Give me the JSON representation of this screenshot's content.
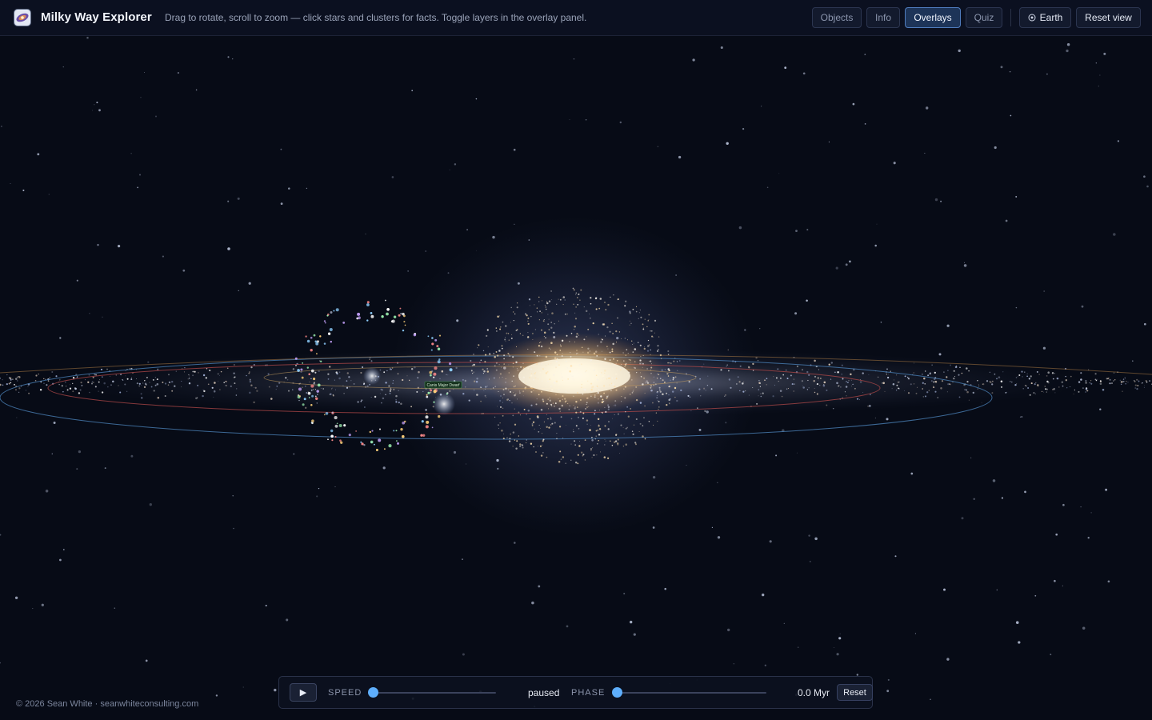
{
  "header": {
    "title": "Milky Way Explorer",
    "hint": "Drag to rotate, scroll to zoom — click stars and clusters for facts. Toggle layers in the overlay panel.",
    "tabs": [
      {
        "label": "Objects",
        "active": false
      },
      {
        "label": "Info",
        "active": false
      },
      {
        "label": "Overlays",
        "active": true
      },
      {
        "label": "Quiz",
        "active": false
      }
    ],
    "earth_label": "Earth",
    "earth_icon": "target-icon",
    "reset_view_label": "Reset view"
  },
  "scene": {
    "marker_label": "Canis Major Dwarf"
  },
  "controls": {
    "play_icon": "▶",
    "speed_label": "SPEED",
    "speed_value": 0.0,
    "speed_status": "paused",
    "phase_label": "PHASE",
    "phase_value": 0.0,
    "time_readout": "0.0 Myr",
    "reset_label": "Reset"
  },
  "footer": {
    "copyright": "© 2026 Sean White · seanwhiteconsulting.com"
  },
  "colors": {
    "accent": "#5eaefc",
    "active_tab": "#1d3458",
    "background": "#070b16",
    "bulge": "#ffe7b0",
    "orbit_blue": "#4a7fb5",
    "orbit_red": "#b04848"
  }
}
